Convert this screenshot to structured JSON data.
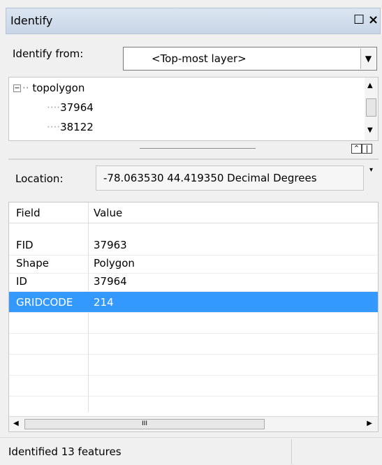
{
  "window": {
    "title": "Identify",
    "restore_glyph": "☐",
    "close_glyph": "×"
  },
  "identify_from": {
    "label": "Identify from:",
    "selected": "<Top-most layer>"
  },
  "tree": {
    "layer": "topolygon",
    "expander": "−",
    "items": [
      "37964",
      "38122"
    ]
  },
  "location": {
    "label": "Location:",
    "value": "-78.063530  44.419350 Decimal Degrees"
  },
  "table": {
    "columns": [
      "Field",
      "Value"
    ],
    "rows": [
      {
        "field": "FID",
        "value": "37963"
      },
      {
        "field": "Shape",
        "value": "Polygon"
      },
      {
        "field": "ID",
        "value": "37964"
      },
      {
        "field": "GRIDCODE",
        "value": "214"
      }
    ],
    "selected_row": "GRIDCODE",
    "selection_color": "#3399ff"
  },
  "status": {
    "text": "Identified 13 features"
  }
}
